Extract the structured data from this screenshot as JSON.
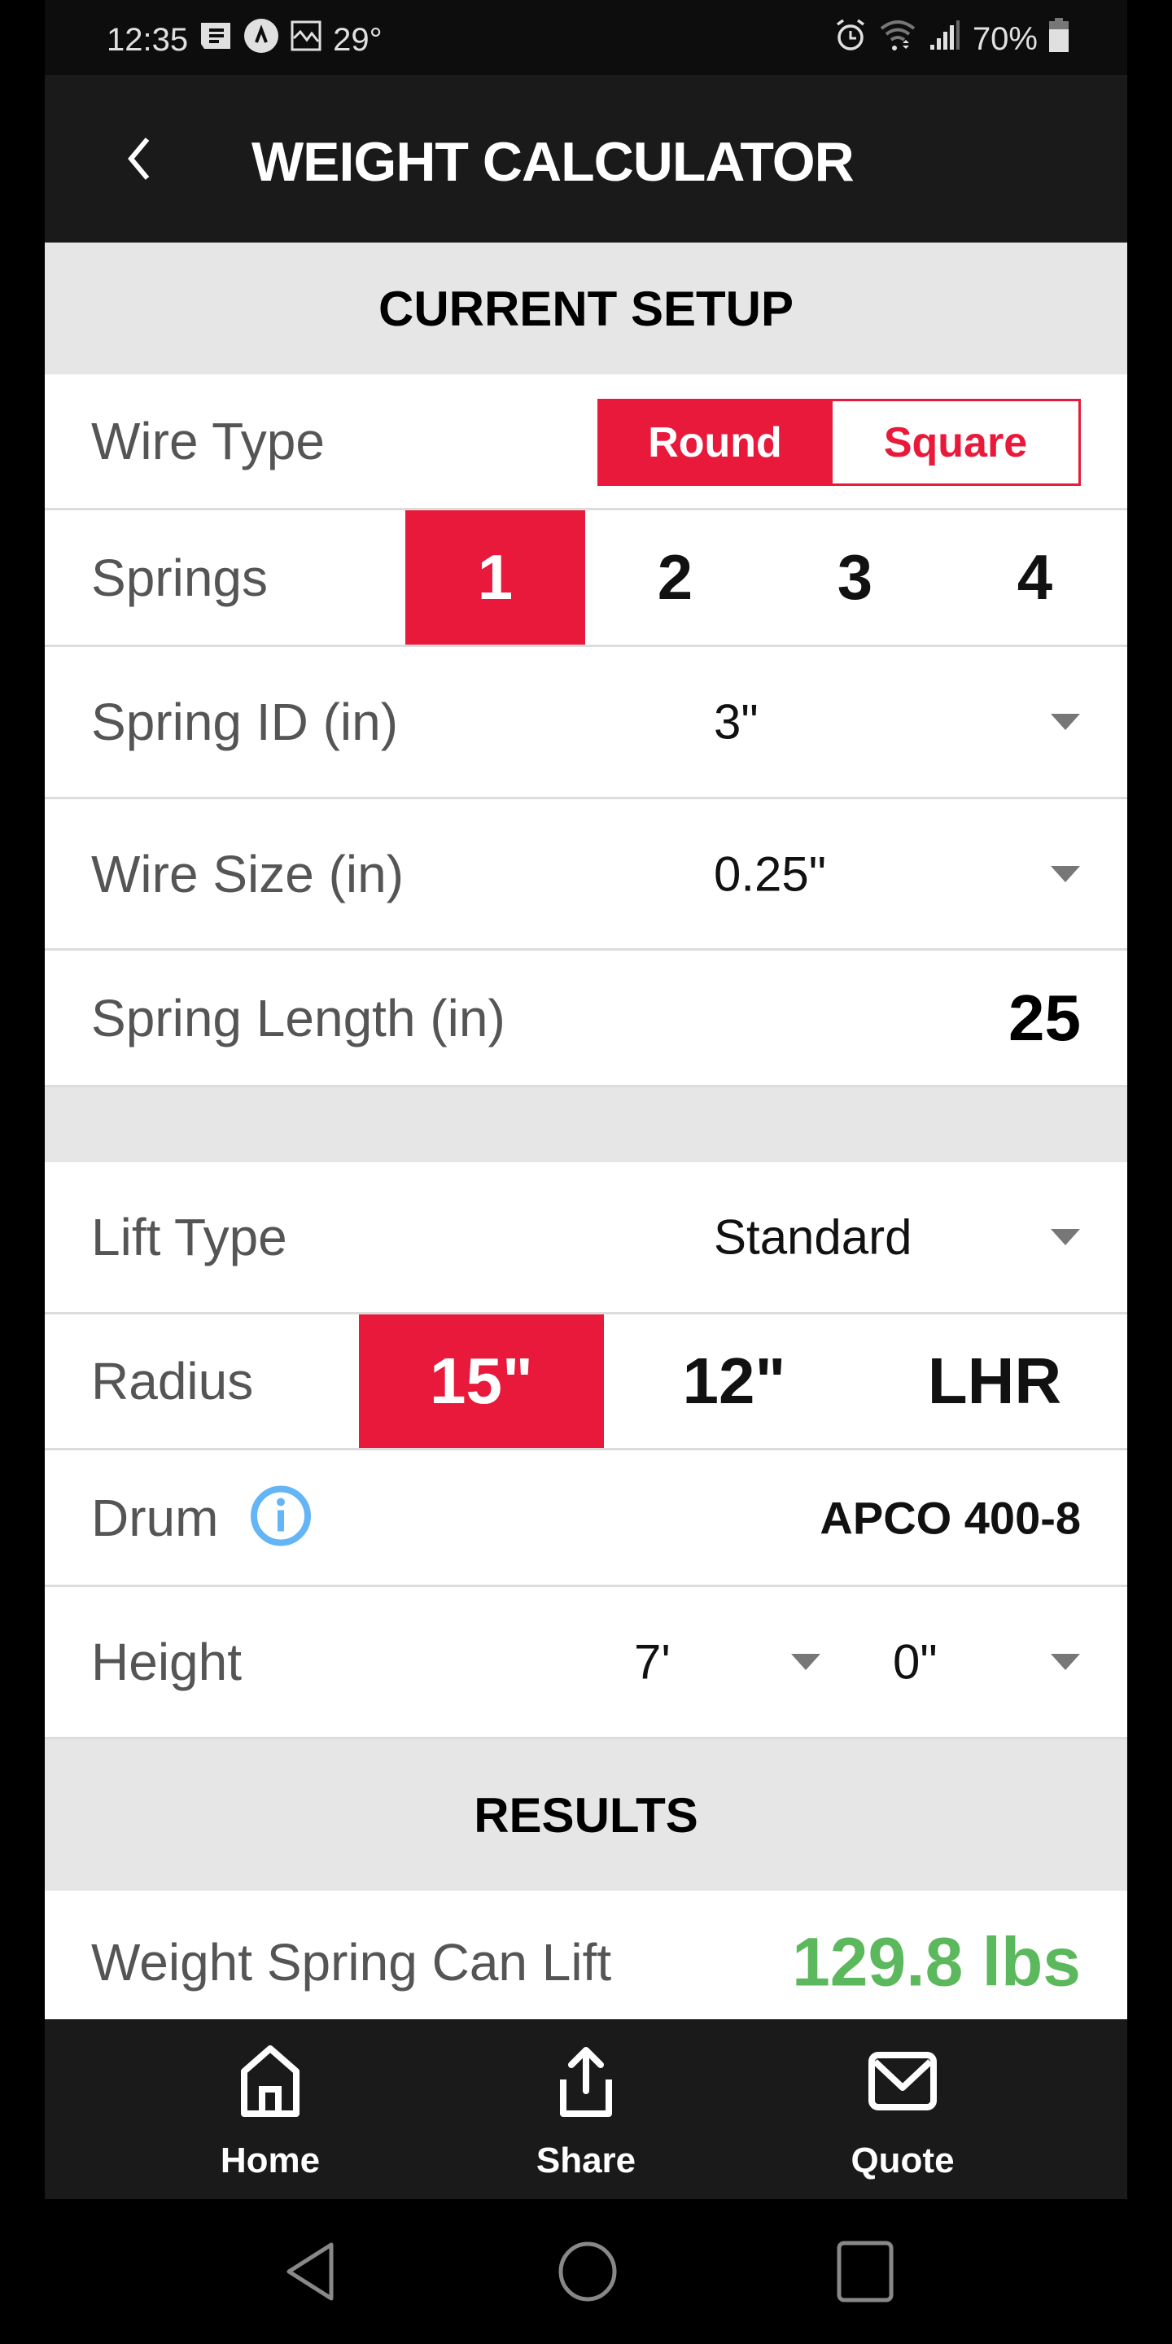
{
  "status_bar": {
    "time": "12:35",
    "temperature": "29°",
    "battery": "70%",
    "left_icons": [
      "message-icon",
      "app-a-icon",
      "image-icon"
    ],
    "right_icons": [
      "alarm-icon",
      "wifi-icon",
      "signal-icon",
      "battery-icon"
    ]
  },
  "header": {
    "title": "WEIGHT CALCULATOR",
    "back_icon": "chevron-left-icon"
  },
  "current_setup": {
    "heading": "CURRENT SETUP",
    "wire_type": {
      "label": "Wire Type",
      "options": [
        "Round",
        "Square"
      ],
      "selected": "Round"
    },
    "springs": {
      "label": "Springs",
      "options": [
        "1",
        "2",
        "3",
        "4"
      ],
      "selected": "1"
    },
    "spring_id": {
      "label": "Spring ID (in)",
      "value": "3\""
    },
    "wire_size": {
      "label": "Wire Size (in)",
      "value": "0.25\""
    },
    "spring_length": {
      "label": "Spring Length (in)",
      "value": "25"
    },
    "lift_type": {
      "label": "Lift Type",
      "value": "Standard"
    },
    "radius": {
      "label": "Radius",
      "options": [
        "15\"",
        "12\"",
        "LHR"
      ],
      "selected": "15\""
    },
    "drum": {
      "label": "Drum",
      "value": "APCO 400-8",
      "info_icon": "info-icon"
    },
    "height": {
      "label": "Height",
      "feet": "7'",
      "inches": "0\""
    }
  },
  "results": {
    "heading": "RESULTS",
    "weight_label": "Weight Spring Can Lift",
    "weight_value": "129.8 lbs"
  },
  "bottom_nav": [
    {
      "label": "Home",
      "icon": "home-icon"
    },
    {
      "label": "Share",
      "icon": "share-icon"
    },
    {
      "label": "Quote",
      "icon": "mail-icon"
    }
  ],
  "colors": {
    "accent_red": "#e8193a",
    "result_green": "#5cb85c",
    "info_blue": "#64b5f6",
    "header_bg": "#1a1a1a",
    "section_bg": "#e6e6e6"
  }
}
